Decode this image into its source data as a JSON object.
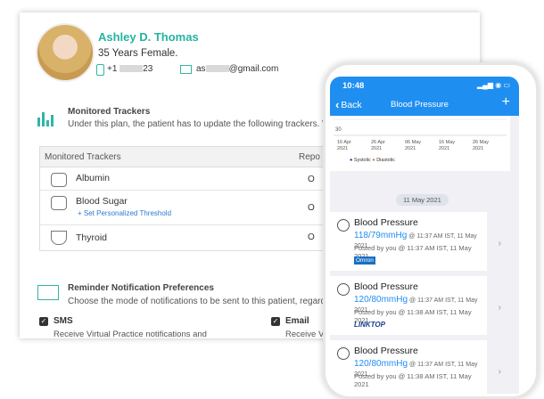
{
  "patient": {
    "name": "Ashley D. Thomas",
    "info": "35 Years Female.",
    "phone_prefix": "+1",
    "phone_suffix": "23",
    "email_prefix": "as",
    "email_suffix": "@gmail.com"
  },
  "trackers": {
    "title": "Monitored Trackers",
    "subtitle": "Under this plan, the patient has to update the following trackers. Where a",
    "col_tracker": "Monitored Trackers",
    "col_report": "Repo",
    "rows": [
      {
        "label": "Albumin",
        "value": "O"
      },
      {
        "label": "Blood Sugar",
        "link": "+ Set Personalized Threshold",
        "value": "O"
      },
      {
        "label": "Thyroid",
        "value": "O"
      }
    ]
  },
  "reminder": {
    "title": "Reminder Notification Preferences",
    "subtitle": "Choose the mode of notifications to be sent to this patient, regarding",
    "sms_label": "SMS",
    "sms_desc": "Receive Virtual Practice notifications and",
    "email_label": "Email",
    "email_desc": "Receive V"
  },
  "phone": {
    "time": "10:48",
    "status_icons": "▂▄▆ ◉ ▭",
    "back_label": "Back",
    "title": "Blood Pressure",
    "add_label": "+",
    "chart": {
      "ytick": "30",
      "dates": [
        "16 Apr 2021",
        "26 Apr 2021",
        "06 May 2021",
        "16 May 2021",
        "26 May 2021"
      ],
      "legend": [
        "Systolic",
        "Diastolic"
      ],
      "colors": {
        "systolic": "#1a3c8e",
        "diastolic": "#e07b2a"
      }
    },
    "date_pill": "11 May 2021",
    "entries": [
      {
        "title": "Blood Pressure",
        "value": "118/79mmHg",
        "meta": "@ 11:37 AM IST, 11 May 2021",
        "posted": "Posted by you @ 11:37 AM IST, 11 May 2021",
        "source": "Omron"
      },
      {
        "title": "Blood Pressure",
        "value": "120/80mmHg",
        "meta": "@ 11:37 AM IST, 11 May 2021",
        "posted": "Posted by you @ 11:38 AM IST, 11 May 2021",
        "source": "LINKTOP"
      },
      {
        "title": "Blood Pressure",
        "value": "120/80mmHg",
        "meta": "@ 11:37 AM IST, 11 May 2021",
        "posted": "Posted by you @ 11:38 AM IST, 11 May 2021"
      }
    ]
  }
}
